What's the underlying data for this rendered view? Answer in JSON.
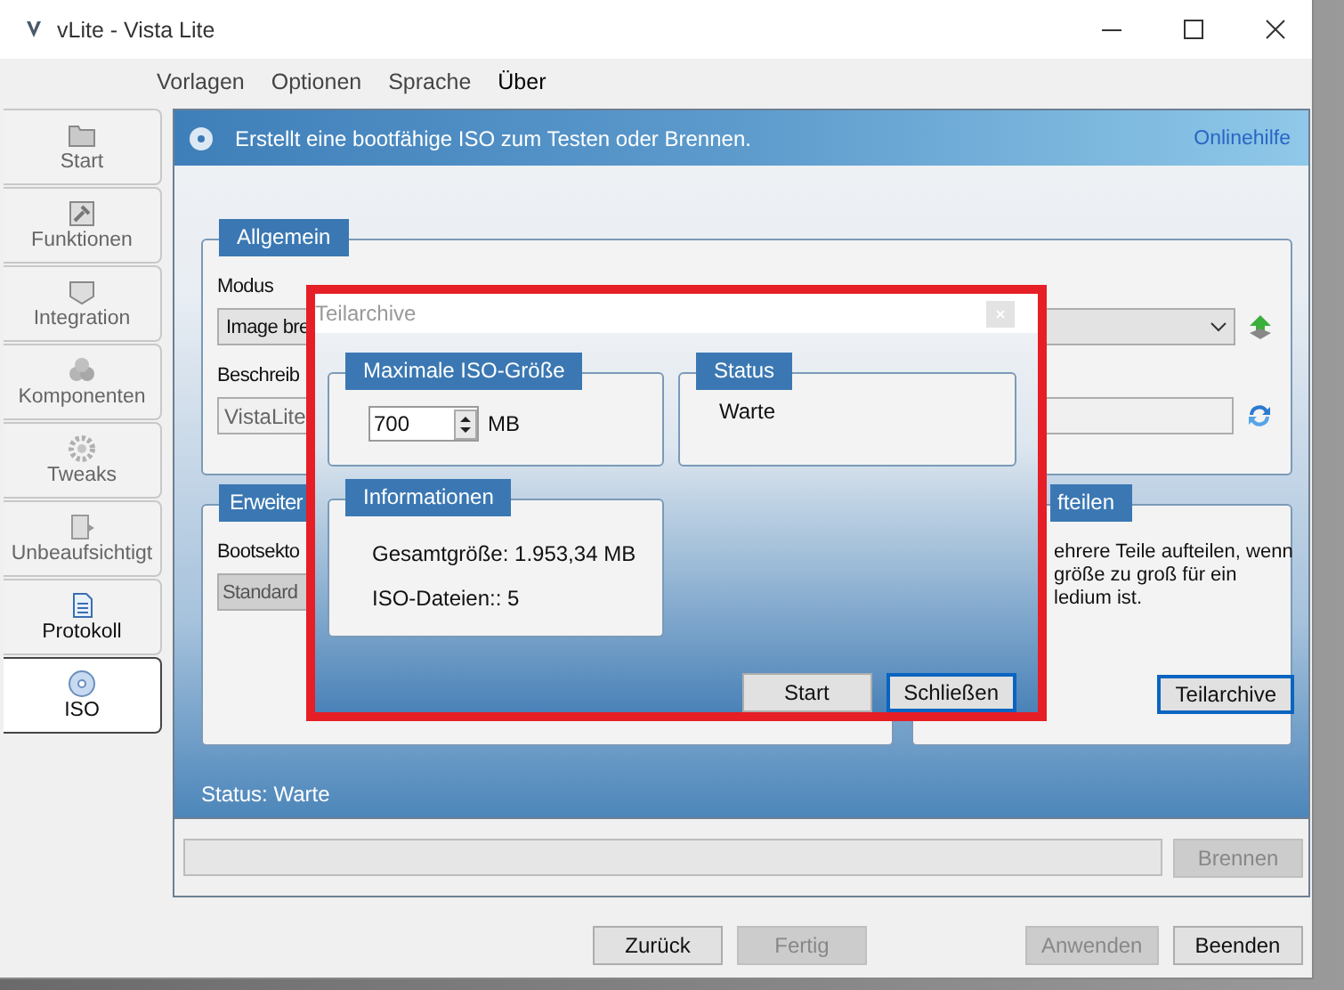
{
  "window": {
    "title": "vLite - Vista Lite"
  },
  "menu": [
    {
      "label": "Vorlagen",
      "selected": false
    },
    {
      "label": "Optionen",
      "selected": false
    },
    {
      "label": "Sprache",
      "selected": false
    },
    {
      "label": "Über",
      "selected": true
    }
  ],
  "sidebar": {
    "items": [
      {
        "label": "Start",
        "disabled": true,
        "selected": false
      },
      {
        "label": "Funktionen",
        "disabled": true,
        "selected": false
      },
      {
        "label": "Integration",
        "disabled": true,
        "selected": false
      },
      {
        "label": "Komponenten",
        "disabled": true,
        "selected": false
      },
      {
        "label": "Tweaks",
        "disabled": true,
        "selected": false
      },
      {
        "label": "Unbeaufsichtigt",
        "disabled": true,
        "selected": false
      },
      {
        "label": "Protokoll",
        "disabled": false,
        "selected": false
      },
      {
        "label": "ISO",
        "disabled": false,
        "selected": true
      }
    ]
  },
  "header": {
    "text": "Erstellt eine bootfähige ISO zum Testen oder Brennen.",
    "link": "Onlinehilfe"
  },
  "general": {
    "title": "Allgemein",
    "mode_label": "Modus",
    "mode_value": "Image bre",
    "description_label": "Beschreib",
    "description_value": "VistaLite"
  },
  "advanced": {
    "title": "Erweiter",
    "bootsector_label": "Bootsekto",
    "bootsector_value": "Standard"
  },
  "split": {
    "title": "fteilen",
    "lines": [
      "ehrere Teile aufteilen, wenn",
      "größe zu groß für ein",
      "ledium ist."
    ],
    "button": "Teilarchive"
  },
  "status": "Status: Warte",
  "progress": {
    "level": 0
  },
  "burn_button": {
    "label": "Brennen",
    "disabled": true
  },
  "footer_buttons": [
    {
      "label": "Zurück",
      "disabled": false
    },
    {
      "label": "Fertig",
      "disabled": true
    },
    {
      "label": "Anwenden",
      "disabled": true
    },
    {
      "label": "Beenden",
      "disabled": false
    }
  ],
  "dialog": {
    "title": "Teilarchive",
    "size_group": {
      "title": "Maximale ISO-Größe",
      "value": "700",
      "unit": "MB"
    },
    "status_group": {
      "title": "Status",
      "text": "Warte"
    },
    "info_group": {
      "title": "Informationen",
      "lines": [
        "Gesamtgröße: 1.953,34 MB",
        "ISO-Dateien:: 5"
      ]
    },
    "buttons": [
      {
        "label": "Start",
        "default": false
      },
      {
        "label": "Schließen",
        "default": true
      }
    ]
  }
}
